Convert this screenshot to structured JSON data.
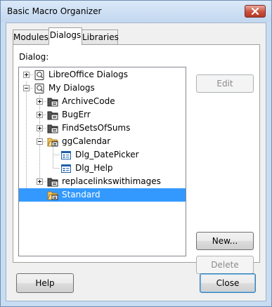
{
  "window": {
    "title": "Basic Macro Organizer"
  },
  "tabs": [
    {
      "label": "Modules",
      "active": false
    },
    {
      "label": "Dialogs",
      "active": true
    },
    {
      "label": "Libraries",
      "active": false
    }
  ],
  "panel": {
    "label": "Dialog:"
  },
  "tree": {
    "items": [
      {
        "label": "LibreOffice Dialogs",
        "icon": "library-icon",
        "expander": "plus",
        "selected": false
      },
      {
        "label": "My Dialogs",
        "icon": "library-icon",
        "expander": "minus",
        "selected": false
      },
      {
        "label": "ArchiveCode",
        "icon": "dialog-library-icon",
        "expander": "plus",
        "selected": false
      },
      {
        "label": "BugErr",
        "icon": "dialog-library-icon",
        "expander": "plus",
        "selected": false
      },
      {
        "label": "FindSetsOfSums",
        "icon": "dialog-library-icon",
        "expander": "plus",
        "selected": false
      },
      {
        "label": "ggCalendar",
        "icon": "open-dialog-library-icon",
        "expander": "minus",
        "selected": false
      },
      {
        "label": "Dlg_DatePicker",
        "icon": "dialog-icon",
        "expander": "",
        "selected": false
      },
      {
        "label": "Dlg_Help",
        "icon": "dialog-icon",
        "expander": "",
        "selected": false
      },
      {
        "label": "replacelinkswithimages",
        "icon": "dialog-library-icon",
        "expander": "plus",
        "selected": false
      },
      {
        "label": "Standard",
        "icon": "open-dialog-library-icon",
        "expander": "",
        "selected": true
      }
    ]
  },
  "buttons": {
    "edit": "Edit",
    "new": "New...",
    "delete": "Delete",
    "help": "Help",
    "close": "Close"
  },
  "colors": {
    "selection": "#3399ff",
    "title_bar": "#c8dcf2",
    "dialog_bg": "#f0f0f0"
  }
}
